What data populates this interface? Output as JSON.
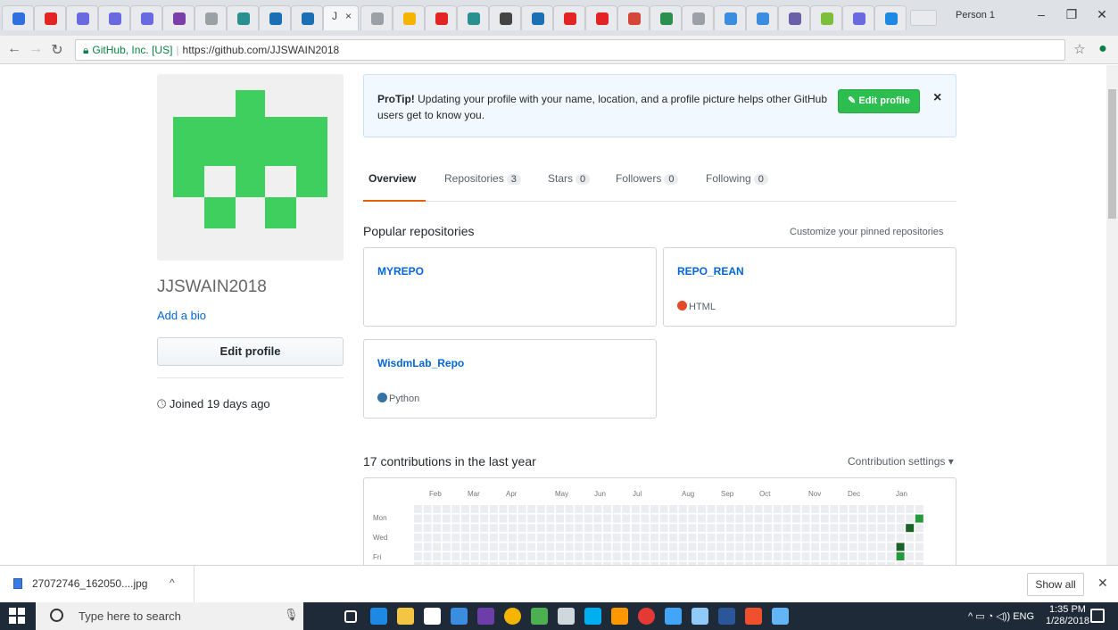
{
  "browser": {
    "profile_name": "Person 1",
    "active_tab_label": "J",
    "address": {
      "site_identity": "GitHub, Inc. [US]",
      "url": "https://github.com/JJSWAIN2018"
    }
  },
  "profile": {
    "username": "JJSWAIN2018",
    "add_bio_label": "Add a bio",
    "edit_profile_label": "Edit profile",
    "joined_text": "Joined 19 days ago"
  },
  "protip": {
    "bold": "ProTip!",
    "text": " Updating your profile with your name, location, and a profile picture helps other GitHub users get to know you.",
    "edit_button_label": "Edit profile",
    "close_label": "×"
  },
  "tabs": [
    {
      "label": "Overview",
      "count": null
    },
    {
      "label": "Repositories",
      "count": "3"
    },
    {
      "label": "Stars",
      "count": "0"
    },
    {
      "label": "Followers",
      "count": "0"
    },
    {
      "label": "Following",
      "count": "0"
    }
  ],
  "popular": {
    "title": "Popular repositories",
    "customize_label": "Customize your pinned repositories",
    "repos": [
      {
        "name": "MYREPO",
        "language": "",
        "language_color": ""
      },
      {
        "name": "REPO_REAN",
        "language": "HTML",
        "language_color": "#e34c26"
      },
      {
        "name": "WisdmLab_Repo",
        "language": "Python",
        "language_color": "#3572A5"
      }
    ]
  },
  "contributions": {
    "title": "17 contributions in the last year",
    "settings_label": "Contribution settings ▾",
    "months": [
      "Feb",
      "Mar",
      "Apr",
      "May",
      "Jun",
      "Jul",
      "Aug",
      "Sep",
      "Oct",
      "Nov",
      "Dec",
      "Jan"
    ],
    "day_labels": [
      "Mon",
      "Wed",
      "Fri"
    ],
    "empty_color": "#ebedf0",
    "active_cells": [
      {
        "week": 51,
        "day": 4,
        "color": "#196127"
      },
      {
        "week": 51,
        "day": 5,
        "color": "#239a3b"
      },
      {
        "week": 52,
        "day": 2,
        "color": "#196127"
      },
      {
        "week": 53,
        "day": 1,
        "color": "#239a3b"
      }
    ]
  },
  "download_bar": {
    "file_name": "27072746_162050....jpg",
    "show_all_label": "Show all"
  },
  "taskbar": {
    "search_placeholder": "Type here to search",
    "language": "ENG",
    "time": "1:35 PM",
    "date": "1/28/2018"
  },
  "colors": {
    "avatar_green": "#3ecf5f",
    "link_blue": "#0366d6",
    "tab_underline": "#e36209",
    "primary_button": "#2cbe4e"
  }
}
